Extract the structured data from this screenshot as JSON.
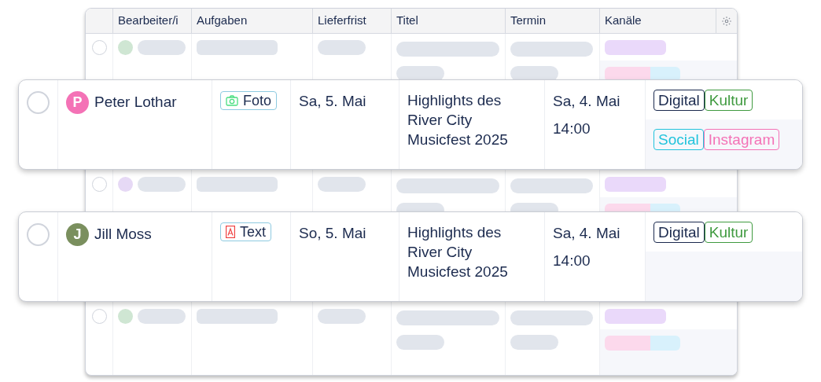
{
  "table": {
    "columns": [
      "Bearbeiter/i",
      "Aufgaben",
      "Lieferfrist",
      "Titel",
      "Termin",
      "Kanäle"
    ],
    "skeleton_rows": [
      {
        "kind": "skeleton",
        "checked": false,
        "color": "#cfe6d3"
      },
      {
        "kind": "skeleton",
        "checked": false,
        "color": "#e6d9f5"
      },
      {
        "kind": "skeleton",
        "checked": false,
        "color": "#cfe6d3"
      }
    ]
  },
  "cards": [
    {
      "checked": false,
      "assignee": {
        "initial": "P",
        "name": "Peter Lothar",
        "color": "#f472b6"
      },
      "task": {
        "kind": "photo",
        "label": "Foto"
      },
      "deadline": "Sa, 5. Mai",
      "title": "Highlights des River City Musicfest 2025",
      "date": "Sa, 4. Mai",
      "time": "14:00",
      "channel_groups": [
        [
          {
            "label": "Digital",
            "color": "#1b2a4e"
          },
          {
            "label": "Kultur",
            "color": "#3f9a3f"
          }
        ],
        [
          {
            "label": "Social",
            "color": "#22c3dc"
          },
          {
            "label": "Instagram",
            "color": "#f472b6"
          }
        ]
      ]
    },
    {
      "checked": false,
      "assignee": {
        "initial": "J",
        "name": "Jill Moss",
        "color": "#7a8f5e"
      },
      "task": {
        "kind": "text",
        "label": "Text"
      },
      "deadline": "So, 5. Mai",
      "title": "Highlights des River City Musicfest 2025",
      "date": "Sa, 4. Mai",
      "time": "14:00",
      "channel_groups": [
        [
          {
            "label": "Digital",
            "color": "#1b2a4e"
          },
          {
            "label": "Kultur",
            "color": "#3f9a3f"
          }
        ]
      ]
    }
  ]
}
